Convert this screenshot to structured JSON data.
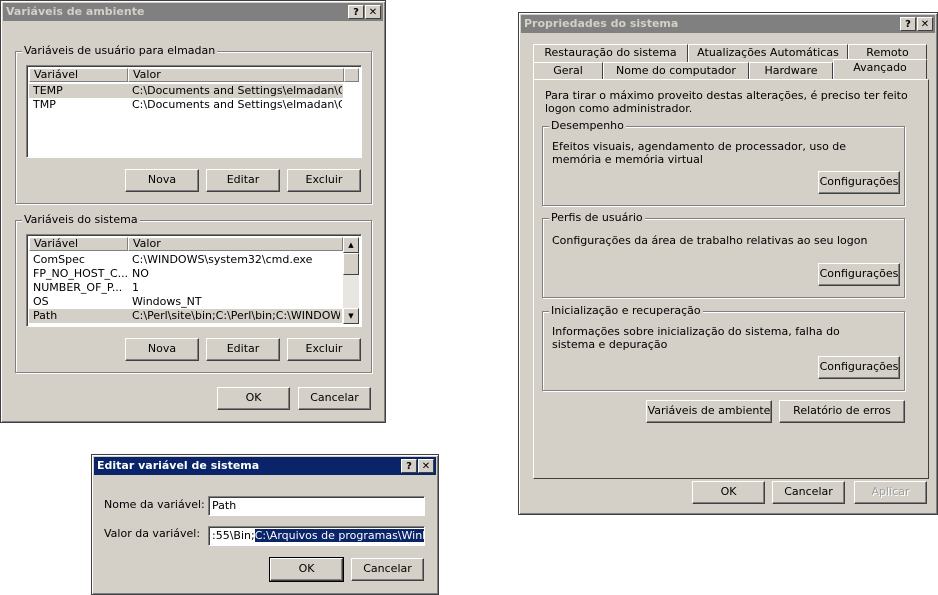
{
  "env_dialog": {
    "title": "Variáveis de ambiente",
    "help_btn": "?",
    "close_btn": "✕",
    "user_group_label": "Variáveis de usuário para elmadan",
    "columns": [
      "Variável",
      "Valor"
    ],
    "user_vars": [
      {
        "name": "TEMP",
        "value": "C:\\Documents and Settings\\elmadan\\Co..."
      },
      {
        "name": "TMP",
        "value": "C:\\Documents and Settings\\elmadan\\Co..."
      }
    ],
    "system_group_label": "Variáveis do sistema",
    "system_vars": [
      {
        "name": "ComSpec",
        "value": "C:\\WINDOWS\\system32\\cmd.exe"
      },
      {
        "name": "FP_NO_HOST_C...",
        "value": "NO"
      },
      {
        "name": "NUMBER_OF_P...",
        "value": "1"
      },
      {
        "name": "OS",
        "value": "Windows_NT"
      },
      {
        "name": "Path",
        "value": "C:\\Perl\\site\\bin;C:\\Perl\\bin;C:\\WINDOW..."
      }
    ],
    "new_label": "Nova",
    "edit_label": "Editar",
    "delete_label": "Excluir",
    "ok_label": "OK",
    "cancel_label": "Cancelar"
  },
  "edit_dialog": {
    "title": "Editar variável de sistema",
    "help_btn": "?",
    "close_btn": "✕",
    "name_label": "Nome da variável:",
    "name_value": "Path",
    "value_label": "Valor da variável:",
    "value_prefix": ":55\\Bin;",
    "value_selected": "C:\\Arquivos de programas\\WinRAR",
    "ok_label": "OK",
    "cancel_label": "Cancelar"
  },
  "sys_props": {
    "title": "Propriedades do sistema",
    "help_btn": "?",
    "close_btn": "✕",
    "tabs_row1": [
      "Restauração do sistema",
      "Atualizações Automáticas",
      "Remoto"
    ],
    "tabs_row2": [
      "Geral",
      "Nome do computador",
      "Hardware",
      "Avançado"
    ],
    "intro": "Para tirar o máximo proveito destas alterações, é preciso ter feito logon como administrador.",
    "perf_label": "Desempenho",
    "perf_desc": "Efeitos visuais, agendamento de processador, uso de memória e memória virtual",
    "profiles_label": "Perfis de usuário",
    "profiles_desc": "Configurações da área de trabalho relativas ao seu logon",
    "startup_label": "Inicialização e recuperação",
    "startup_desc": "Informações sobre inicialização do sistema, falha do sistema e depuração",
    "settings_label": "Configurações",
    "env_vars_label": "Variáveis de ambiente",
    "error_report_label": "Relatório de erros",
    "ok_label": "OK",
    "cancel_label": "Cancelar",
    "apply_label": "Aplicar"
  }
}
